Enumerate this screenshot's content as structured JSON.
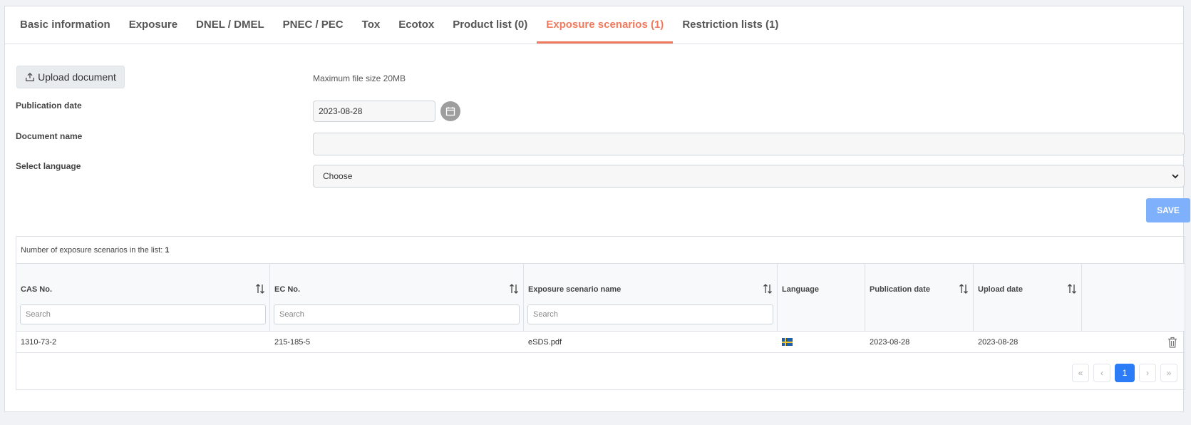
{
  "tabs": [
    {
      "label": "Basic information"
    },
    {
      "label": "Exposure"
    },
    {
      "label": "DNEL / DMEL"
    },
    {
      "label": "PNEC / PEC"
    },
    {
      "label": "Tox"
    },
    {
      "label": "Ecotox"
    },
    {
      "label": "Product list (0)"
    },
    {
      "label": "Exposure scenarios (1)",
      "active": true
    },
    {
      "label": "Restriction lists (1)"
    }
  ],
  "upload": {
    "label": "Upload document",
    "max_size": "Maximum file size 20MB"
  },
  "form": {
    "publication_date_label": "Publication date",
    "publication_date_value": "2023-08-28",
    "document_name_label": "Document name",
    "document_name_value": "",
    "language_label": "Select language",
    "language_value": "Choose",
    "save_label": "SAVE"
  },
  "table": {
    "count_label": "Number of exposure scenarios in the list:",
    "count_value": "1",
    "columns": [
      {
        "label": "CAS No.",
        "sortable": true,
        "search_placeholder": "Search"
      },
      {
        "label": "EC No.",
        "sortable": true,
        "search_placeholder": "Search"
      },
      {
        "label": "Exposure scenario name",
        "sortable": true,
        "search_placeholder": "Search"
      },
      {
        "label": "Language",
        "sortable": false
      },
      {
        "label": "Publication date",
        "sortable": true
      },
      {
        "label": "Upload date",
        "sortable": true
      }
    ],
    "rows": [
      {
        "cas": "1310-73-2",
        "ec": "215-185-5",
        "name": "eSDS.pdf",
        "language_flag": "sweden-flag",
        "publication_date": "2023-08-28",
        "upload_date": "2023-08-28"
      }
    ]
  },
  "pager": {
    "first": "«",
    "prev": "‹",
    "current": "1",
    "next": "›",
    "last": "»"
  },
  "colors": {
    "active_tab": "#f07a5e",
    "save_button": "#7fb0fb",
    "pager_current": "#2b7cf6"
  }
}
